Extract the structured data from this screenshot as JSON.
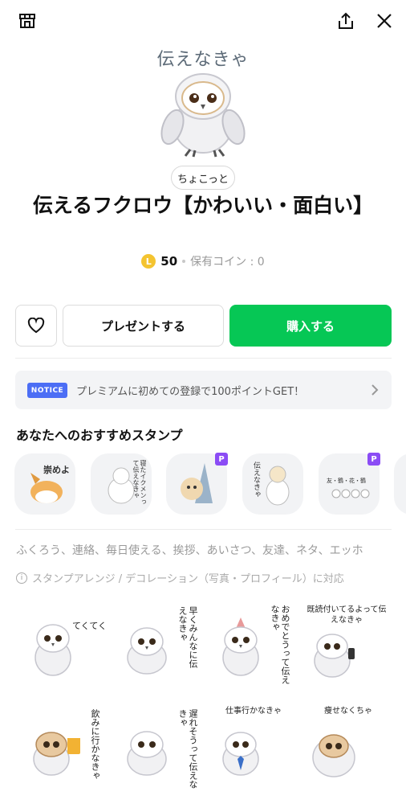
{
  "topbar": {
    "shop_icon": "shop-icon",
    "share_icon": "share-icon",
    "close_icon": "close-icon"
  },
  "hero": {
    "caption": "伝えなきゃ"
  },
  "tag": "ちょこっと",
  "title": "伝えるフクロウ【かわいい・面白い】",
  "price": {
    "coin_letter": "L",
    "amount": "50",
    "holding": "保有コイン : 0"
  },
  "actions": {
    "favorite_icon": "heart-icon",
    "gift_label": "プレゼントする",
    "buy_label": "購入する"
  },
  "notice": {
    "badge": "NOTICE",
    "text": "プレミアムに初めての登録で100ポイントGET！"
  },
  "recommend": {
    "title": "あなたへのおすすめスタンプ",
    "items": [
      {
        "text": "崇めよ",
        "premium": false
      },
      {
        "text": "寝たイクメンって伝えなきゃ",
        "premium": false
      },
      {
        "text": "",
        "premium": true
      },
      {
        "text": "伝えなきゃ",
        "premium": false
      },
      {
        "text": "友・鶴・花・鶴",
        "premium": true
      }
    ],
    "premium_badge": "P"
  },
  "tags_line": "ふくろう、連絡、毎日使える、挨拶、あいさつ、友達、ネタ、エッホ",
  "info_line": "スタンプアレンジ / デコレーション（写真・プロフィール）に対応",
  "stickers": [
    {
      "text": "てくてく"
    },
    {
      "text": "早くみんなに伝えなきゃ"
    },
    {
      "text": "おめでとうって伝えなきゃ"
    },
    {
      "text": "既読付いてるよって伝えなきゃ"
    },
    {
      "text": "飲みに行かなきゃ"
    },
    {
      "text": "遅れそうって伝えなきゃ"
    },
    {
      "text": "仕事行かなきゃ"
    },
    {
      "text": "痩せなくちゃ"
    }
  ],
  "colors": {
    "buy_green": "#06c755",
    "notice_blue": "#4c6ef5",
    "premium_purple": "#8b4cf5",
    "coin_gold": "#f4c430"
  }
}
